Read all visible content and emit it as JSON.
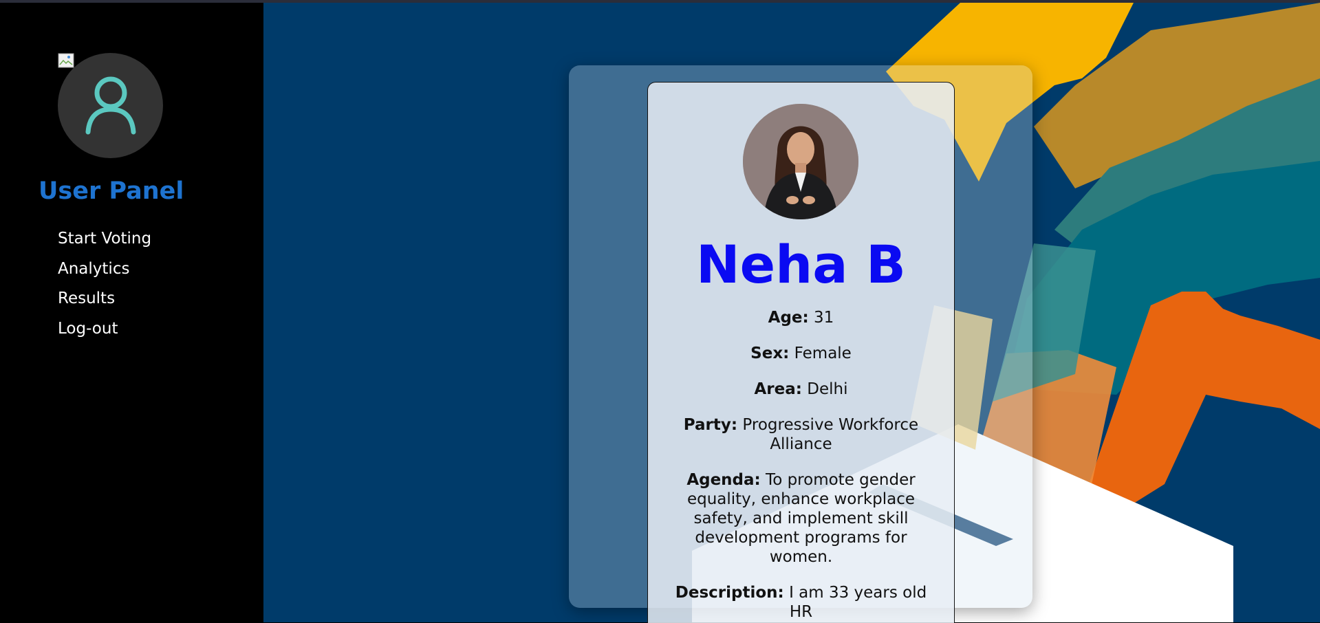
{
  "sidebar": {
    "avatar_icon": "user-icon",
    "title": "User Panel",
    "items": [
      {
        "label": "Start Voting"
      },
      {
        "label": "Analytics"
      },
      {
        "label": "Results"
      },
      {
        "label": "Log-out"
      }
    ]
  },
  "candidate": {
    "name": "Neha B",
    "fields": [
      {
        "label": "Age:",
        "value": "31"
      },
      {
        "label": "Sex:",
        "value": "Female"
      },
      {
        "label": "Area:",
        "value": "Delhi"
      },
      {
        "label": "Party:",
        "value": "Progressive Workforce Alliance"
      },
      {
        "label": "Agenda:",
        "value": "To promote gender equality, enhance workplace safety, and implement skill development programs for women."
      },
      {
        "label": "Description:",
        "value": "I am 33 years old HR"
      }
    ]
  },
  "colors": {
    "sidebar_bg": "#000000",
    "title": "#1e73d0",
    "main_bg": "#003b6a",
    "name": "#0a0af2",
    "avatar_icon": "#5bc8c0"
  }
}
